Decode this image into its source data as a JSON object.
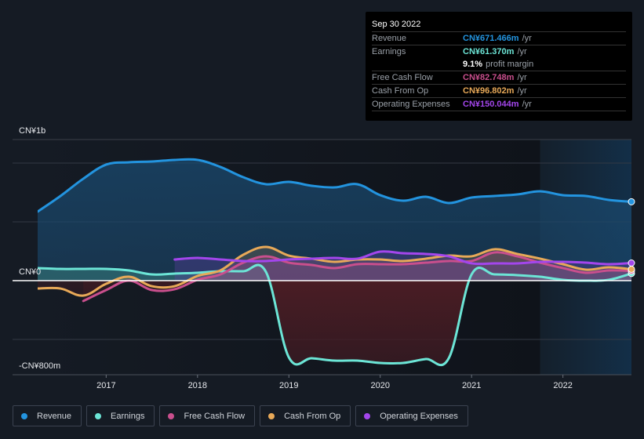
{
  "tooltip": {
    "date": "Sep 30 2022",
    "rows": [
      {
        "label": "Revenue",
        "value": "CN¥671.466m",
        "unit": "/yr",
        "color": "#2394df"
      },
      {
        "label": "Earnings",
        "value": "CN¥61.370m",
        "unit": "/yr",
        "color": "#6ce5d6"
      },
      {
        "label": "",
        "value": "9.1%",
        "unit": "profit margin",
        "color": "#ffffff"
      },
      {
        "label": "Free Cash Flow",
        "value": "CN¥82.748m",
        "unit": "/yr",
        "color": "#c94f8d"
      },
      {
        "label": "Cash From Op",
        "value": "CN¥96.802m",
        "unit": "/yr",
        "color": "#e8a958"
      },
      {
        "label": "Operating Expenses",
        "value": "CN¥150.044m",
        "unit": "/yr",
        "color": "#a346ec"
      }
    ]
  },
  "legend": [
    {
      "label": "Revenue",
      "color": "#2394df"
    },
    {
      "label": "Earnings",
      "color": "#6ce5d6"
    },
    {
      "label": "Free Cash Flow",
      "color": "#c94f8d"
    },
    {
      "label": "Cash From Op",
      "color": "#e8a958"
    },
    {
      "label": "Operating Expenses",
      "color": "#a346ec"
    }
  ],
  "chart_data": {
    "type": "line",
    "title": "",
    "xlabel": "",
    "ylabel": "",
    "y_unit": "CN¥ millions",
    "ylim": [
      -800,
      1200
    ],
    "xlim": [
      2016.25,
      2022.75
    ],
    "y_tick_labels": [
      {
        "value": 1000,
        "label": "CN¥1b"
      },
      {
        "value": 0,
        "label": "CN¥0"
      },
      {
        "value": -800,
        "label": "-CN¥800m"
      }
    ],
    "x_ticks": [
      2017,
      2018,
      2019,
      2020,
      2021,
      2022
    ],
    "x_tick_labels": [
      "2017",
      "2018",
      "2019",
      "2020",
      "2021",
      "2022"
    ],
    "grid_values": [
      1000,
      500,
      0,
      -500
    ],
    "highlight_from": 2021.75,
    "legend_position": "bottom",
    "x": [
      2016.25,
      2016.5,
      2016.75,
      2017.0,
      2017.25,
      2017.5,
      2017.75,
      2018.0,
      2018.25,
      2018.5,
      2018.75,
      2019.0,
      2019.25,
      2019.5,
      2019.75,
      2020.0,
      2020.25,
      2020.5,
      2020.75,
      2021.0,
      2021.25,
      2021.5,
      2021.75,
      2022.0,
      2022.25,
      2022.5,
      2022.75
    ],
    "series": [
      {
        "name": "Revenue",
        "color": "#2394df",
        "values": [
          587,
          720,
          867,
          987,
          1007,
          1013,
          1027,
          1027,
          967,
          880,
          820,
          840,
          807,
          793,
          820,
          727,
          680,
          713,
          660,
          707,
          720,
          733,
          760,
          727,
          720,
          687,
          671
        ]
      },
      {
        "name": "Earnings",
        "color": "#6ce5d6",
        "values": [
          107,
          100,
          100,
          100,
          87,
          53,
          60,
          67,
          80,
          80,
          73,
          -653,
          -660,
          -680,
          -680,
          -700,
          -700,
          -667,
          -660,
          53,
          53,
          47,
          33,
          7,
          0,
          7,
          61
        ]
      },
      {
        "name": "Free Cash Flow",
        "color": "#c94f8d",
        "values": [
          null,
          null,
          -173,
          -80,
          0,
          -80,
          -73,
          7,
          53,
          153,
          207,
          153,
          133,
          107,
          140,
          140,
          140,
          153,
          167,
          167,
          240,
          207,
          153,
          107,
          67,
          87,
          83
        ]
      },
      {
        "name": "Cash From Op",
        "color": "#e8a958",
        "values": [
          -67,
          -67,
          -127,
          -27,
          33,
          -47,
          -47,
          40,
          87,
          220,
          287,
          213,
          187,
          160,
          180,
          180,
          167,
          187,
          213,
          207,
          267,
          227,
          187,
          140,
          93,
          113,
          97
        ]
      },
      {
        "name": "Operating Expenses",
        "color": "#a346ec",
        "values": [
          null,
          null,
          null,
          null,
          null,
          null,
          180,
          193,
          180,
          167,
          167,
          180,
          187,
          193,
          187,
          247,
          233,
          227,
          207,
          147,
          147,
          147,
          160,
          160,
          153,
          140,
          150
        ]
      }
    ]
  }
}
